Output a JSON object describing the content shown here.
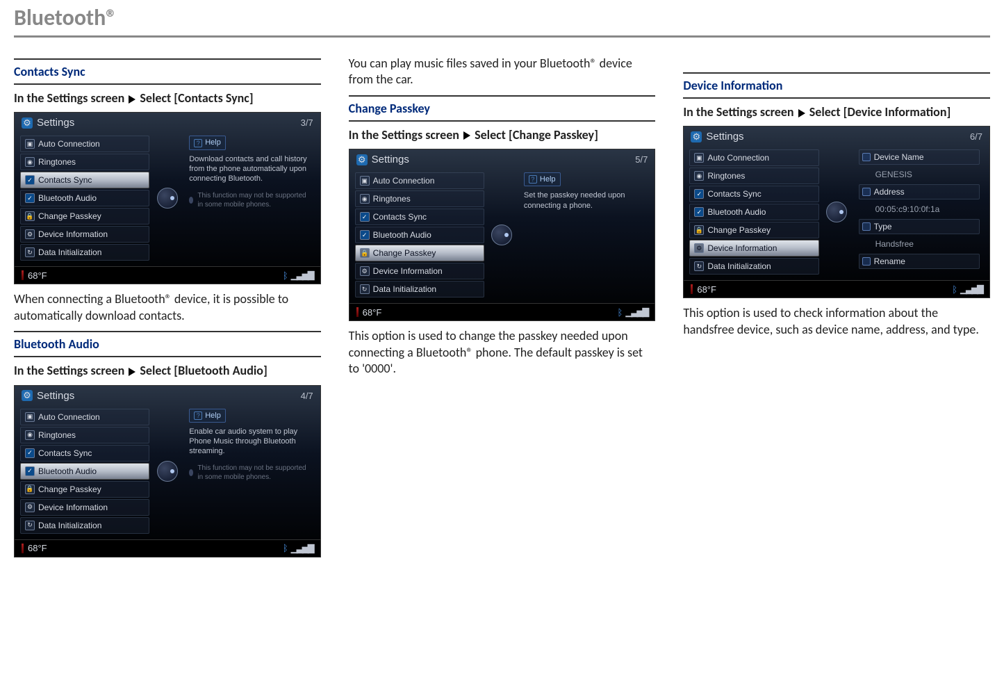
{
  "page_title": "Bluetooth®",
  "sections": {
    "contacts_sync": {
      "heading": "Contacts Sync",
      "instruction_prefix": "In the Settings screen",
      "instruction_action": "Select [Contacts Sync]",
      "after_text": "When connecting a Bluetooth® device, it is possible to automatically download contacts."
    },
    "bluetooth_audio": {
      "heading": "Bluetooth Audio",
      "instruction_prefix": "In the Settings screen",
      "instruction_action": "Select [Bluetooth Audio]",
      "before_text": "You can play music files saved in your Bluetooth® device from the car."
    },
    "change_passkey": {
      "heading": "Change Passkey",
      "instruction_prefix": "In the Settings screen",
      "instruction_action": "Select [Change Passkey]",
      "after_text": "This option is used to change the passkey needed upon connecting a Bluetooth® phone. The default passkey is set to '0000'."
    },
    "device_info": {
      "heading": "Device Information",
      "instruction_prefix": "In the Settings screen",
      "instruction_action": "Select [Device Information]",
      "after_text": "This option is used to check information about the handsfree device, such as device name, address, and type."
    }
  },
  "screenshots": {
    "common": {
      "title": "Settings",
      "list_items": [
        "Auto Connection",
        "Ringtones",
        "Contacts Sync",
        "Bluetooth Audio",
        "Change Passkey",
        "Device Information",
        "Data Initialization"
      ],
      "help_label": "Help",
      "temp": "68°F",
      "footnote": "This function may not be supported in some mobile phones."
    },
    "s1": {
      "page": "3/7",
      "selected_index": 2,
      "help_text": "Download contacts and call history from the phone automatically upon connecting Bluetooth.",
      "show_footnote": true
    },
    "s2": {
      "page": "4/7",
      "selected_index": 3,
      "help_text": "Enable car audio system to play Phone Music through Bluetooth streaming.",
      "show_footnote": true
    },
    "s3": {
      "page": "5/7",
      "selected_index": 4,
      "help_text": "Set the passkey needed upon connecting a phone.",
      "show_footnote": false
    },
    "s4": {
      "page": "6/7",
      "selected_index": 5,
      "info": {
        "device_name_label": "Device Name",
        "device_name": "GENESIS",
        "address_label": "Address",
        "address": "00:05:c9:10:0f:1a",
        "type_label": "Type",
        "type": "Handsfree",
        "rename_label": "Rename"
      }
    }
  }
}
